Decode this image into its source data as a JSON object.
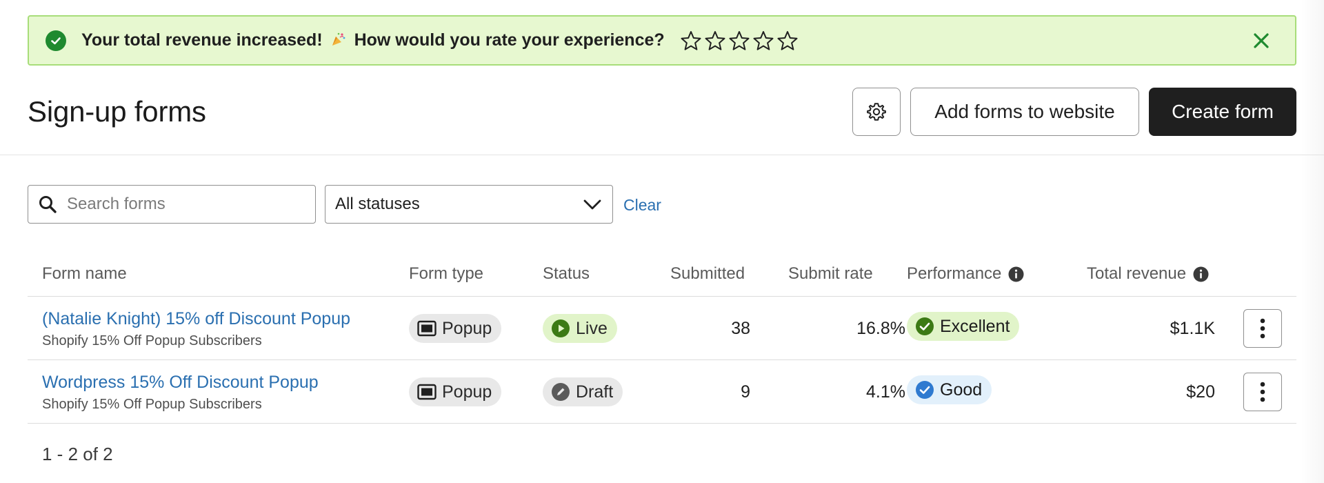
{
  "banner": {
    "message_part1": "Your total revenue increased!",
    "message_part2": "How would you rate your experience?",
    "stars_total": 5,
    "stars_filled": 0,
    "colors": {
      "background": "#e7f8d0",
      "border": "#a7dd79",
      "success": "#1f8a2f"
    }
  },
  "header": {
    "title": "Sign-up forms",
    "add_label": "Add forms to website",
    "create_label": "Create form"
  },
  "filters": {
    "search_placeholder": "Search forms",
    "status_value": "All statuses",
    "clear_label": "Clear"
  },
  "table": {
    "columns": {
      "name": "Form name",
      "type": "Form type",
      "status": "Status",
      "submitted": "Submitted",
      "rate": "Submit rate",
      "performance": "Performance",
      "revenue": "Total revenue"
    },
    "rows": [
      {
        "name": "(Natalie Knight) 15% off Discount Popup",
        "list": "Shopify 15% Off Popup Subscribers",
        "type": "Popup",
        "status": "Live",
        "submitted": "38",
        "rate": "16.8%",
        "performance": "Excellent",
        "revenue": "$1.1K"
      },
      {
        "name": "Wordpress 15% Off Discount Popup",
        "list": "Shopify 15% Off Popup Subscribers",
        "type": "Popup",
        "status": "Draft",
        "submitted": "9",
        "rate": "4.1%",
        "performance": "Good",
        "revenue": "$20"
      }
    ]
  },
  "pagination": {
    "label": "1 - 2 of 2"
  },
  "icons": [
    "check-circle-icon",
    "party-popper-icon",
    "star-outline-icon",
    "close-icon",
    "gear-icon",
    "search-icon",
    "chevron-down-icon",
    "info-icon",
    "popup-icon",
    "play-icon",
    "pencil-icon",
    "check-badge-icon",
    "kebab-menu-icon"
  ]
}
